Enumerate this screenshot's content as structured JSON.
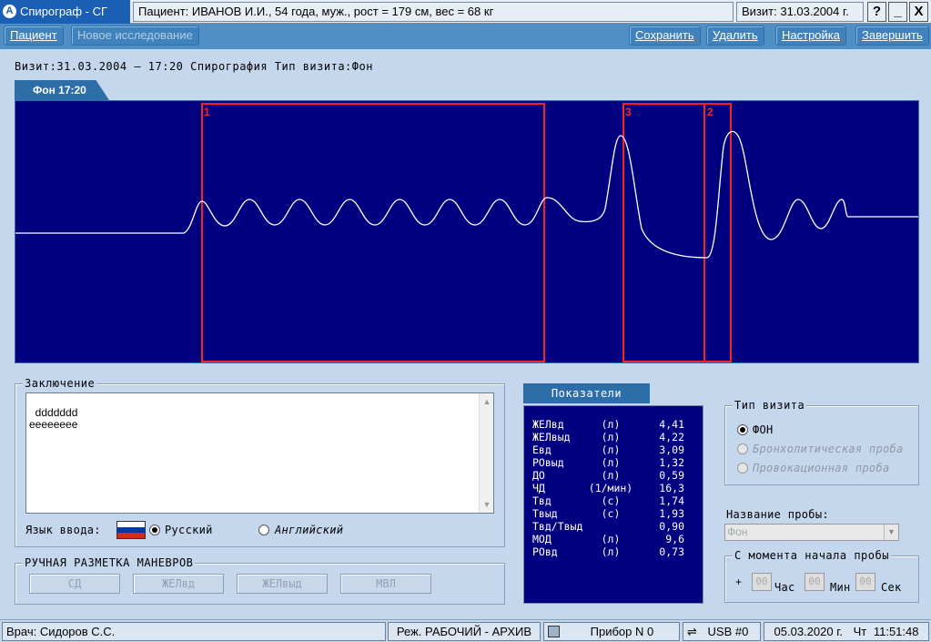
{
  "titlebar": {
    "app_title": "Спирограф - СГ",
    "patient": "Пациент:  ИВАНОВ И.И., 54 года, муж., рост = 179 см, вес = 68 кг",
    "visit": "Визит:  31.03.2004 г.",
    "help": "?",
    "minimize": "_",
    "close": "X"
  },
  "toolbar": {
    "patient": "Пациент",
    "new_study": "Новое исследование",
    "save": "Сохранить",
    "delete": "Удалить",
    "settings": "Настройка",
    "finish": "Завершить"
  },
  "visit_line": "Визит:31.03.2004 – 17:20 Спирография Тип визита:Фон",
  "tab": "Фон 17:20",
  "chart_data": {
    "type": "line",
    "title": "",
    "xlabel": "",
    "ylabel": "",
    "segments": [
      {
        "label": "1"
      },
      {
        "label": "2"
      },
      {
        "label": "3"
      }
    ],
    "colors": {
      "background": "#000080",
      "line": "#ffffff",
      "segment": "#ff2020"
    }
  },
  "conclusion": {
    "title": "Заключение",
    "text": "ddddddd\neeeeeeee",
    "lang_label": "Язык ввода:",
    "lang_ru": "Русский",
    "lang_en": "Английский",
    "selected": "ru"
  },
  "manual": {
    "title": "РУЧНАЯ РАЗМЕТКА МАНЕВРОВ",
    "buttons": [
      "СД",
      "ЖЕЛвд",
      "ЖЕЛвыд",
      "МВЛ"
    ]
  },
  "indicators": {
    "header": "Показатели",
    "rows": [
      {
        "name": "ЖЕЛвд",
        "unit": "(л)",
        "value": "4,41"
      },
      {
        "name": "ЖЕЛвыд",
        "unit": "(л)",
        "value": "4,22"
      },
      {
        "name": "Евд",
        "unit": "(л)",
        "value": "3,09"
      },
      {
        "name": "РОвыд",
        "unit": "(л)",
        "value": "1,32"
      },
      {
        "name": "ДО",
        "unit": "(л)",
        "value": "0,59"
      },
      {
        "name": "ЧД",
        "unit": "(1/мин)",
        "value": "16,3"
      },
      {
        "name": "Твд",
        "unit": "(с)",
        "value": "1,74"
      },
      {
        "name": "Твыд",
        "unit": "(с)",
        "value": "1,93"
      },
      {
        "name": "Твд/Твыд",
        "unit": "",
        "value": "0,90"
      },
      {
        "name": "МОД",
        "unit": "(л)",
        "value": "9,6"
      },
      {
        "name": "РОвд",
        "unit": "(л)",
        "value": "0,73"
      }
    ]
  },
  "visit_type": {
    "title": "Тип визита",
    "options": [
      "ФОН",
      "Бронхолитическая проба",
      "Провокационная проба"
    ]
  },
  "probe": {
    "label": "Название пробы:",
    "value": "Фон"
  },
  "since": {
    "title": "С момента начала пробы",
    "plus": "+",
    "hours": "00",
    "hours_label": "Час",
    "minutes": "00",
    "minutes_label": "Мин",
    "seconds": "00",
    "seconds_label": "Сек"
  },
  "status": {
    "doctor": "Врач: Сидоров С.С.",
    "mode": "Реж. РАБОЧИЙ - АРХИВ",
    "device": "Прибор N 0",
    "usb": "USB #0",
    "date": "05.03.2020 г.",
    "day": "Чт",
    "time": "11:51:48"
  }
}
